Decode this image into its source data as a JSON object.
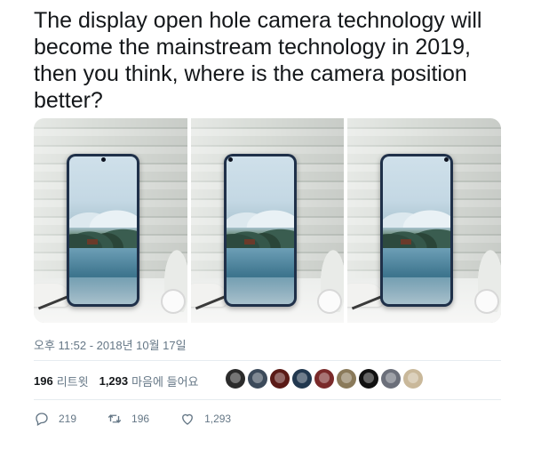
{
  "tweet": {
    "text": "The display open hole camera technology will become the mainstream technology in 2019, then you think, where is the camera position better?"
  },
  "media": {
    "images": [
      {
        "hole_position": "center"
      },
      {
        "hole_position": "left"
      },
      {
        "hole_position": "right"
      }
    ]
  },
  "timestamp": "오후 11:52 - 2018년 10월 17일",
  "stats": {
    "retweets_count": "196",
    "retweets_label": "리트윗",
    "likes_count": "1,293",
    "likes_label": "마음에 들어요"
  },
  "likers": [
    {
      "color": "#2b2b2b"
    },
    {
      "color": "#3c4a5a"
    },
    {
      "color": "#5a1a16"
    },
    {
      "color": "#22384f"
    },
    {
      "color": "#7a2a2a"
    },
    {
      "color": "#8a7a5a"
    },
    {
      "color": "#111111"
    },
    {
      "color": "#6b6f7a"
    },
    {
      "color": "#c9b89a"
    }
  ],
  "actions": {
    "reply_count": "219",
    "retweet_count": "196",
    "like_count": "1,293"
  },
  "colors": {
    "text": "#14171a",
    "muted": "#657786",
    "divider": "#e6ecf0"
  }
}
